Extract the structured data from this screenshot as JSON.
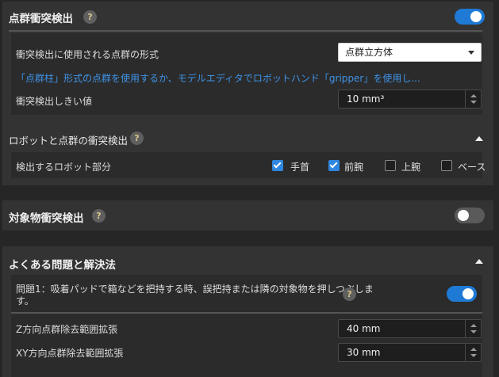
{
  "point_cloud_collision": {
    "title": "点群衝突検出",
    "help": "?",
    "enabled": true,
    "shape_label": "衝突検出に使用される点群の形式",
    "shape_value": "点群立方体",
    "hint_link": "「点群柱」形式の点群を使用するか、モデルエディタでロボットハンド「gripper」を使用し...",
    "threshold_label": "衝突検出しきい値",
    "threshold_value": "10 mm³"
  },
  "robot_collision": {
    "title": "ロボットと点群の衝突検出",
    "help": "?",
    "expanded": true,
    "parts_label": "検出するロボット部分",
    "parts": [
      {
        "label": "手首",
        "checked": true
      },
      {
        "label": "前腕",
        "checked": true
      },
      {
        "label": "上腕",
        "checked": false
      },
      {
        "label": "ベース",
        "checked": false
      }
    ]
  },
  "object_collision": {
    "title": "対象物衝突検出",
    "help": "?",
    "enabled": false
  },
  "faq": {
    "title": "よくある問題と解決法",
    "expanded": true,
    "question1_line1": "問題1：吸着パッドで箱などを把持する時、誤把持または隣の対象物を押しつぶしま",
    "question1_line2": "す。",
    "help": "?",
    "question1_enabled": true,
    "z_label": "Z方向点群除去範囲拡張",
    "z_value": "40 mm",
    "xy_label": "XY方向点群除去範囲拡張",
    "xy_value": "30 mm"
  },
  "colors": {
    "accent": "#1f7ad6",
    "link": "#3e93e8",
    "panel": "#333333",
    "background": "#262626"
  }
}
